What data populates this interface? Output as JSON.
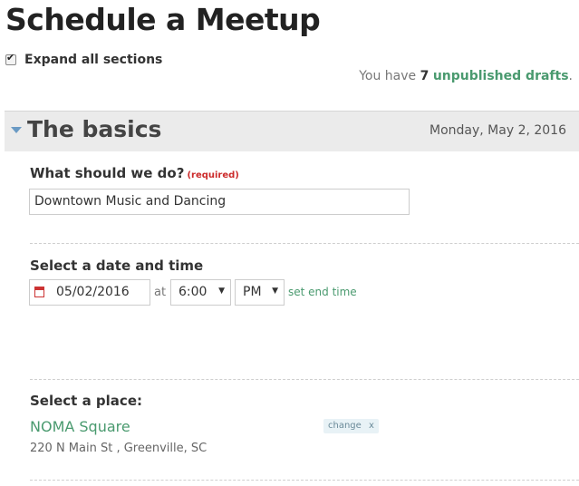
{
  "page": {
    "title": "Schedule a Meetup",
    "expand_label": "Expand all sections",
    "expand_checked": true
  },
  "drafts": {
    "prefix": "You have",
    "count": "7",
    "link": "unpublished drafts",
    "suffix": "."
  },
  "section": {
    "title": "The basics",
    "date": "Monday, May 2, 2016"
  },
  "what": {
    "label": "What should we do?",
    "required": "(required)",
    "value": "Downtown Music and Dancing"
  },
  "datetime": {
    "label": "Select a date and time",
    "date_value": "05/02/2016",
    "at": "at",
    "time_value": "6:00",
    "ampm_value": "PM",
    "end_link": "set end time"
  },
  "place": {
    "label": "Select a place:",
    "name": "NOMA Square",
    "address": "220 N Main St , Greenville, SC",
    "change": "change",
    "remove": "x"
  },
  "colors": {
    "link_green": "#4a9a6f",
    "required_red": "#cc2a2a",
    "section_bar": "#ebebeb",
    "triangle_blue": "#6a9ac4"
  },
  "icons": {
    "checkbox": "check-icon",
    "section_toggle": "triangle-down-icon",
    "date": "calendar-icon",
    "select_arrow": "chevron-down-icon"
  }
}
